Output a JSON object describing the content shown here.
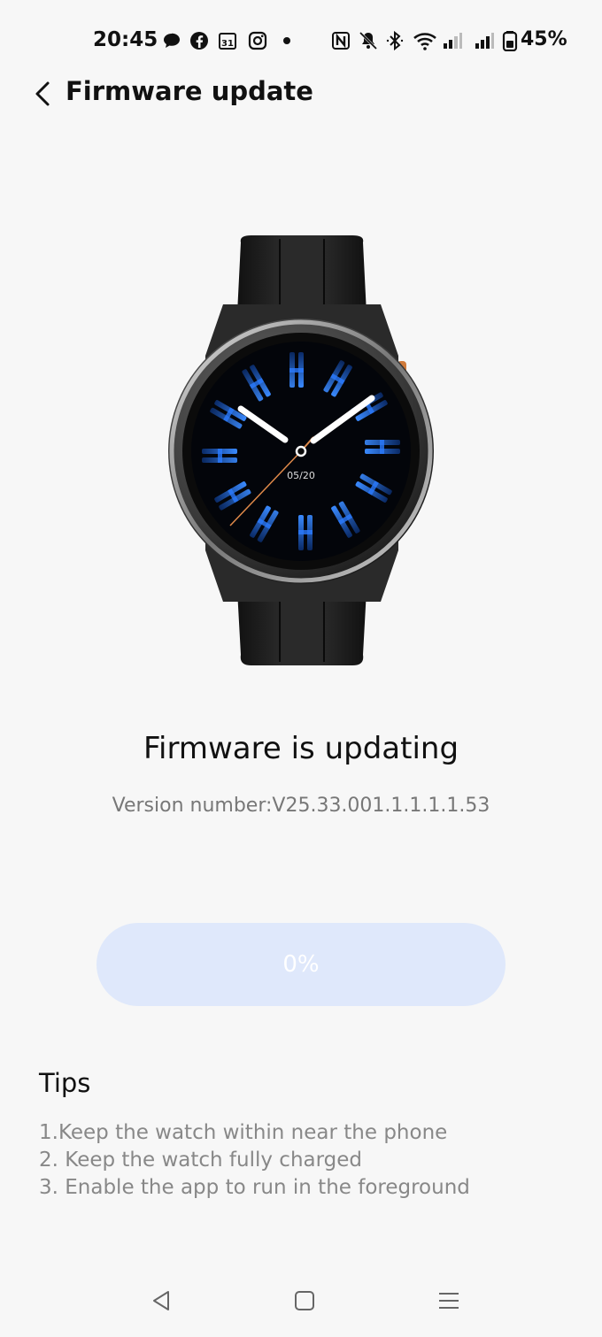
{
  "status_bar": {
    "time": "20:45",
    "battery": "45%",
    "icons": [
      "chat-bubble-icon",
      "facebook-icon",
      "calendar-icon",
      "instagram-icon",
      "dot-icon",
      "nfc-icon",
      "mute-icon",
      "bluetooth-icon",
      "wifi-icon",
      "signal-icon",
      "signal-icon",
      "battery-icon"
    ],
    "calendar_day": "31"
  },
  "header": {
    "title": "Firmware update"
  },
  "watch": {
    "date": "05/20"
  },
  "update": {
    "status": "Firmware is updating",
    "version": "Version number:V25.33.001.1.1.1.1.53",
    "progress_label": "0%",
    "progress_fraction": 0
  },
  "tips": {
    "title": "Tips",
    "items": [
      "1.Keep the watch within near the phone",
      "2. Keep the watch fully charged",
      "3. Enable the app to run in the foreground"
    ]
  },
  "nav": {
    "icons": [
      "back-triangle-icon",
      "home-square-icon",
      "menu-icon"
    ]
  },
  "colors": {
    "progress_track": "#dfe8fb",
    "progress_fill": "#4a7ff0",
    "watch_hands_accent": "#e08a4a",
    "watch_face_accent": "#1e6fff"
  }
}
